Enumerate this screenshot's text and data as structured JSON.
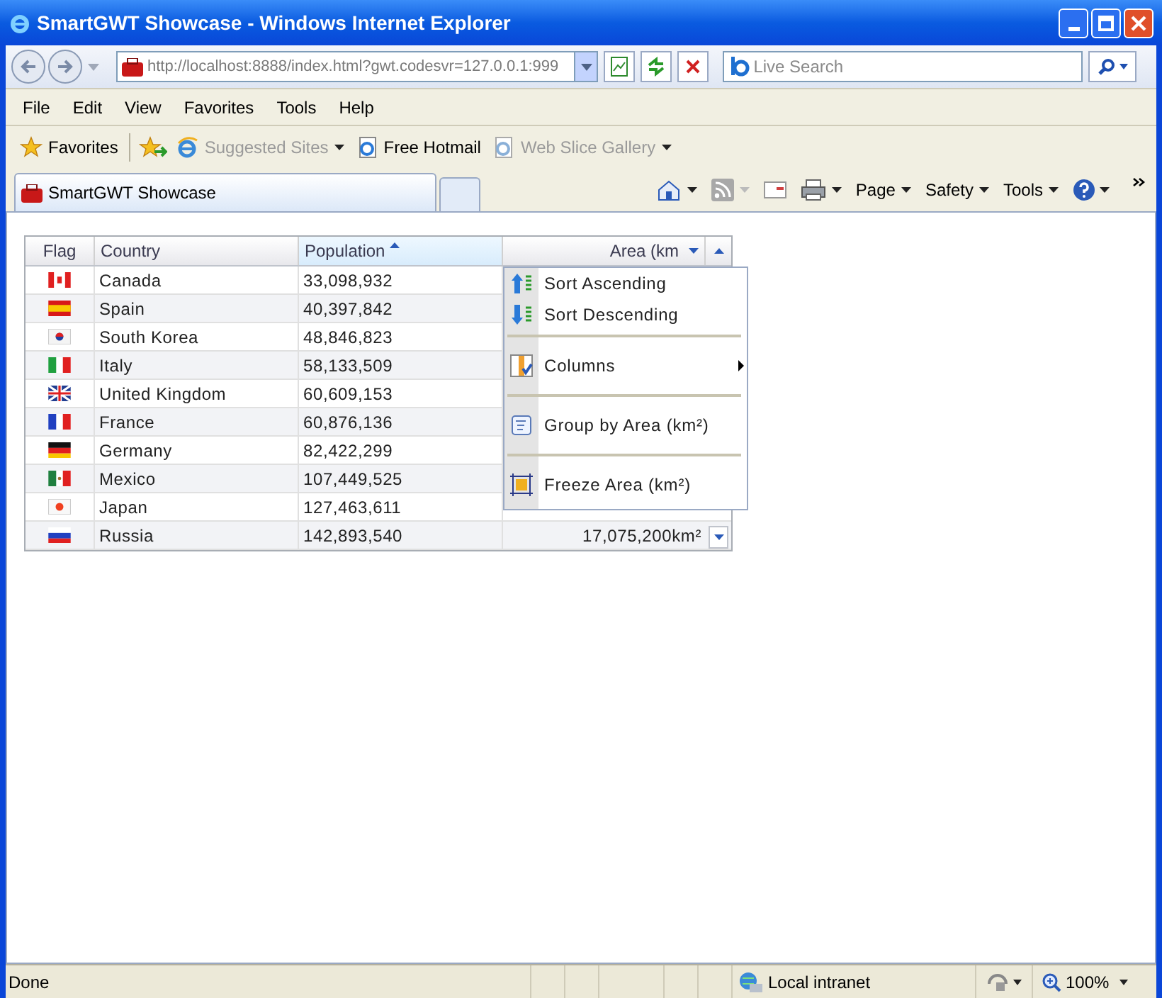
{
  "window": {
    "title": "SmartGWT Showcase - Windows Internet Explorer"
  },
  "address_bar": {
    "url": "http://localhost:8888/index.html?gwt.codesvr=127.0.0.1:999"
  },
  "search": {
    "placeholder": "Live Search"
  },
  "menu_bar": [
    "File",
    "Edit",
    "View",
    "Favorites",
    "Tools",
    "Help"
  ],
  "favorites_bar": [
    {
      "label": "Favorites",
      "disabled": false,
      "dropdown": false
    },
    {
      "label": "Suggested Sites",
      "disabled": true,
      "dropdown": true
    },
    {
      "label": "Free Hotmail",
      "disabled": false,
      "dropdown": false
    },
    {
      "label": "Web Slice Gallery",
      "disabled": true,
      "dropdown": true
    }
  ],
  "tabs": [
    {
      "label": "SmartGWT Showcase",
      "selected": true
    }
  ],
  "command_bar": [
    {
      "label": "Page"
    },
    {
      "label": "Safety"
    },
    {
      "label": "Tools"
    }
  ],
  "grid": {
    "columns": [
      {
        "label": "Flag",
        "sorted": false,
        "menu_open": false
      },
      {
        "label": "Country",
        "sorted": false,
        "menu_open": false
      },
      {
        "label": "Population",
        "sorted": true,
        "menu_open": false
      },
      {
        "label": "Area (km",
        "sorted": false,
        "menu_open": true
      }
    ],
    "rows": [
      {
        "country": "Canada",
        "population": "33,098,932"
      },
      {
        "country": "Spain",
        "population": "40,397,842"
      },
      {
        "country": "South Korea",
        "population": "48,846,823"
      },
      {
        "country": "Italy",
        "population": "58,133,509"
      },
      {
        "country": "United Kingdom",
        "population": "60,609,153"
      },
      {
        "country": "France",
        "population": "60,876,136"
      },
      {
        "country": "Germany",
        "population": "82,422,299"
      },
      {
        "country": "Mexico",
        "population": "107,449,525"
      },
      {
        "country": "Japan",
        "population": "127,463,611"
      },
      {
        "country": "Russia",
        "population": "142,893,540",
        "area": "17,075,200km²"
      }
    ]
  },
  "context_menu": [
    {
      "kind": "item",
      "label": "Sort Ascending",
      "submenu": false
    },
    {
      "kind": "item",
      "label": "Sort Descending",
      "submenu": false
    },
    {
      "kind": "separator"
    },
    {
      "kind": "item",
      "label": "Columns",
      "submenu": true
    },
    {
      "kind": "separator"
    },
    {
      "kind": "item",
      "label": "Group by Area (km²)",
      "submenu": false
    },
    {
      "kind": "separator"
    },
    {
      "kind": "item",
      "label": "Freeze Area (km²)",
      "submenu": false
    }
  ],
  "status_bar": {
    "text": "Done",
    "zone": "Local intranet",
    "zoom": "100%"
  }
}
